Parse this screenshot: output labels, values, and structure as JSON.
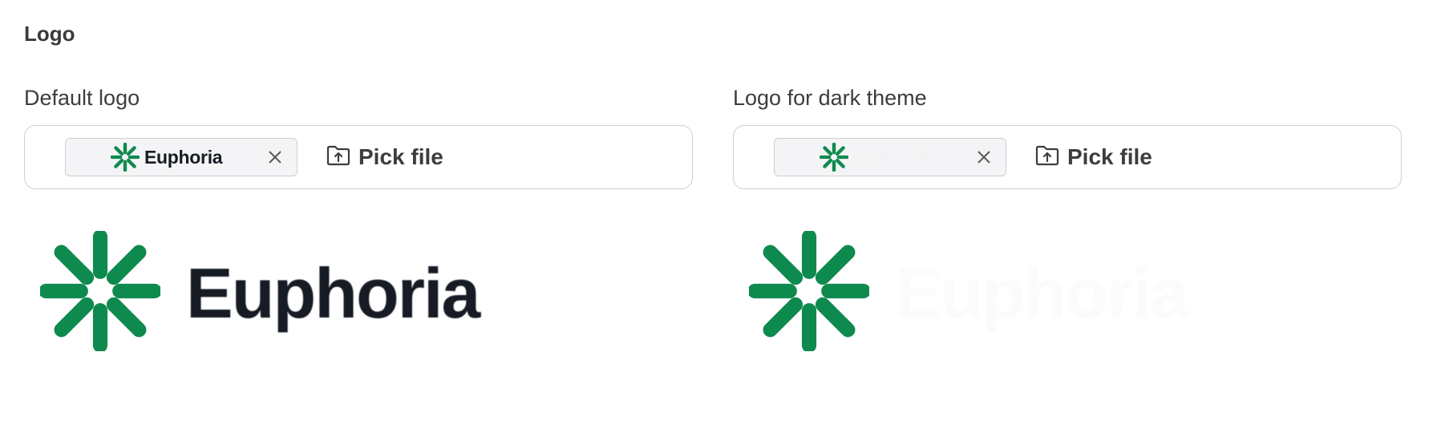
{
  "section": {
    "title": "Logo"
  },
  "default_logo": {
    "label": "Default logo",
    "file_chip": {
      "name": "Euphoria",
      "remove_icon": "close-icon"
    },
    "pick_file_label": "Pick file",
    "pick_file_icon": "folder-upload-icon",
    "preview": {
      "name": "Euphoria",
      "mark_icon": "euphoria-asterisk-logo"
    }
  },
  "dark_logo": {
    "label": "Logo for dark theme",
    "file_chip": {
      "name": "Euphoria",
      "remove_icon": "close-icon"
    },
    "pick_file_label": "Pick file",
    "pick_file_icon": "folder-upload-icon",
    "preview": {
      "name": "Euphoria",
      "mark_icon": "euphoria-asterisk-logo"
    }
  },
  "colors": {
    "brand_green": "#0f8a4f",
    "wordmark_dark": "#161b24",
    "wordmark_light": "#fbfbfc",
    "border": "#cfcfd4",
    "chip_bg": "#f4f4f6",
    "text": "#3d3d3d"
  }
}
